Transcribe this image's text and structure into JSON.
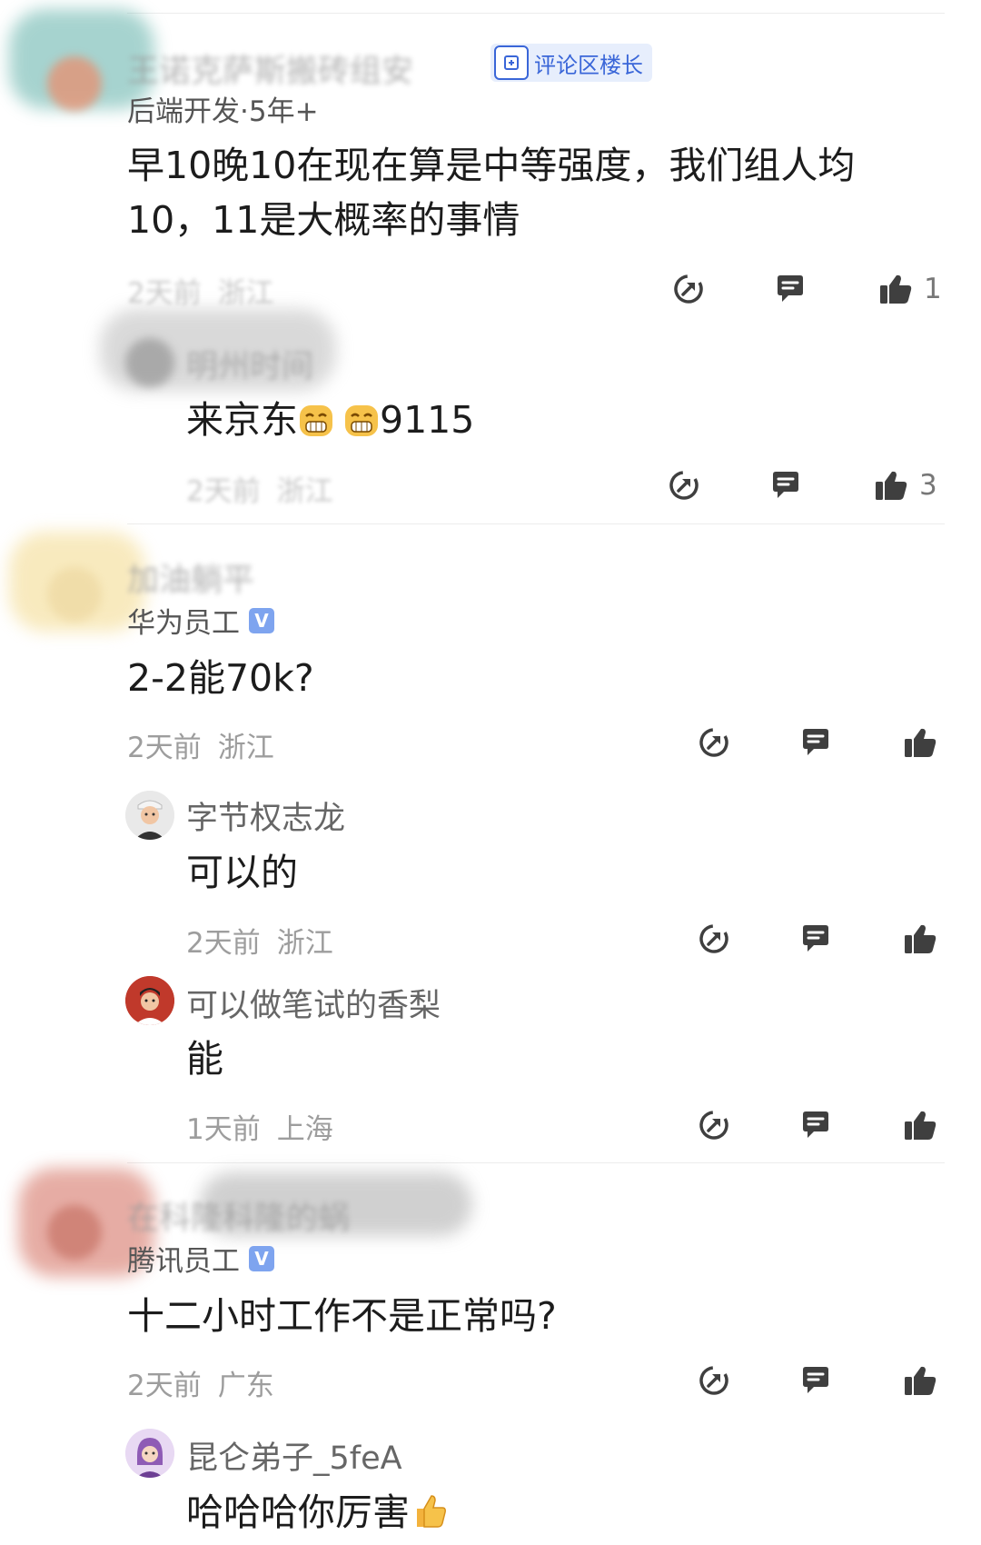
{
  "comments": [
    {
      "author": "王诺克萨斯搬砖组安",
      "badge_label": "评论区楼长",
      "subline": "后端开发·5年+",
      "text_line1": "早10晚10在现在算是中等强度，我们组人均",
      "text_line2": "10，11是大概率的事情",
      "time": "2天前",
      "location": "浙江",
      "likes": "1",
      "replies": [
        {
          "author": "明州时间",
          "text_prefix": "来京东",
          "text_suffix": "9115",
          "time": "2天前",
          "location": "浙江",
          "likes": "3"
        }
      ]
    },
    {
      "author": "加油躺平",
      "subline": "华为员工",
      "verified_mark": "V",
      "text": "2-2能70k?",
      "time": "2天前",
      "location": "浙江",
      "replies": [
        {
          "author": "字节权志龙",
          "text": "可以的",
          "time": "2天前",
          "location": "浙江"
        },
        {
          "author": "可以做笔试的香梨",
          "text": "能",
          "time": "1天前",
          "location": "上海"
        }
      ]
    },
    {
      "author": "在科隆科隆的蜗",
      "subline": "腾讯员工",
      "verified_mark": "V",
      "text": "十二小时工作不是正常吗?",
      "time": "2天前",
      "location": "广东",
      "replies": [
        {
          "author": "昆仑弟子_5feA",
          "text": "哈哈哈你厉害"
        }
      ]
    }
  ],
  "icons": {
    "share": "share-icon",
    "reply": "comment-icon",
    "like": "thumbs-up-icon",
    "grin": "grinning-emoji-icon",
    "thumb_emoji": "thumbs-up-emoji-icon"
  },
  "colors": {
    "icon": "#3f3f3f",
    "meta": "#9d9d9d",
    "badge_bg": "#e7eefc",
    "badge_text": "#3a66d8"
  }
}
